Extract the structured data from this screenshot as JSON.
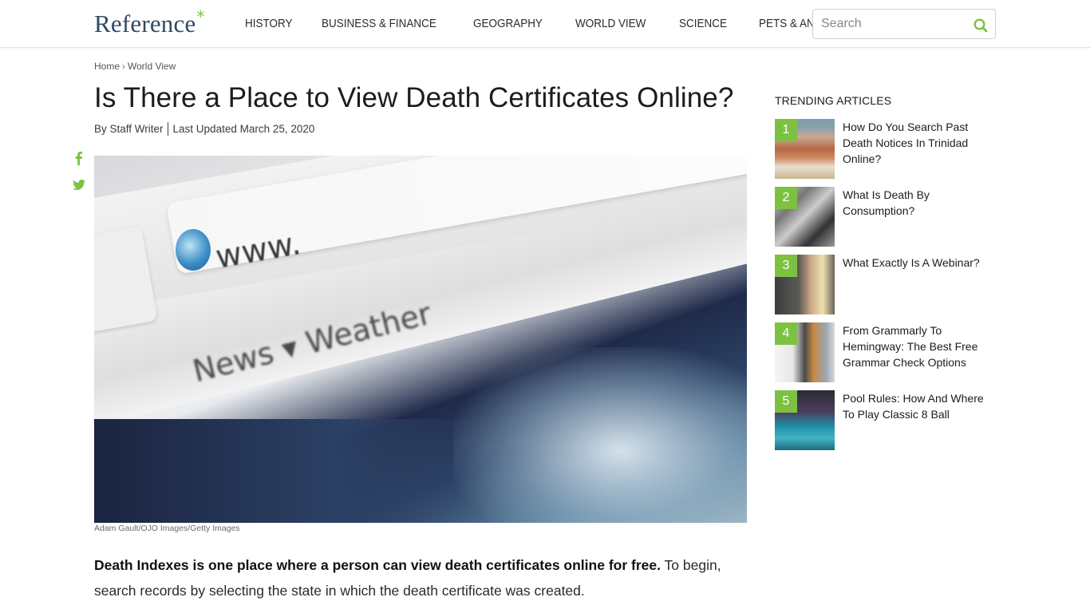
{
  "header": {
    "logo_text": "Reference",
    "logo_mark": "*",
    "nav": [
      "HISTORY",
      "BUSINESS & FINANCE",
      "GEOGRAPHY",
      "WORLD VIEW",
      "SCIENCE",
      "PETS & ANIMALS"
    ],
    "search_placeholder": "Search",
    "search_icon": "search-icon"
  },
  "colors": {
    "accent": "#7dc142",
    "logo": "#2f4a63",
    "text": "#1c1c1c"
  },
  "breadcrumb": {
    "items": [
      "Home",
      "World View"
    ],
    "separator": "›"
  },
  "article": {
    "title": "Is There a Place to View Death Certificates Online?",
    "author": "By Staff Writer",
    "updated": "Last Updated March 25, 2020",
    "image_caption": "Adam Gault/OJO Images/Getty Images",
    "image_alt": "Close-up of web browser address bar showing www. and toolbar items News and Weather",
    "image_text": {
      "address": "www.",
      "toolbar": "News ▾  Weather"
    },
    "lede_bold": "Death Indexes is one place where a person can view death certificates online for free.",
    "lede_rest": " To begin, search records by selecting the state in which the death certificate was created."
  },
  "social": [
    {
      "name": "facebook-icon"
    },
    {
      "name": "twitter-icon"
    }
  ],
  "trending": {
    "title": "TRENDING ARTICLES",
    "items": [
      {
        "rank": "1",
        "title": "How Do You Search Past Death Notices In Trinidad Online?"
      },
      {
        "rank": "2",
        "title": "What Is Death By Consumption?"
      },
      {
        "rank": "3",
        "title": "What Exactly Is A Webinar?"
      },
      {
        "rank": "4",
        "title": "From Grammarly To Hemingway: The Best Free Grammar Check Options"
      },
      {
        "rank": "5",
        "title": "Pool Rules: How And Where To Play Classic 8 Ball"
      }
    ]
  }
}
